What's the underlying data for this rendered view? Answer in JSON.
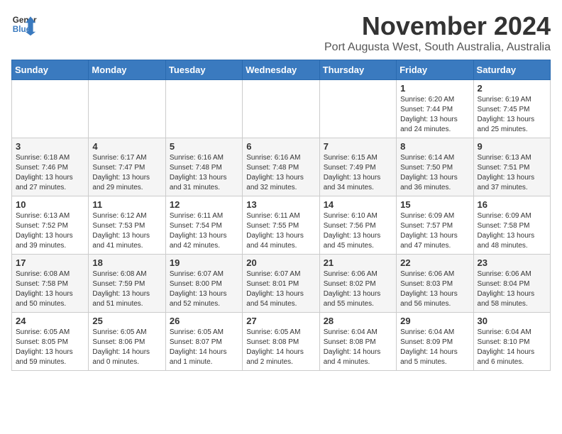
{
  "header": {
    "logo_line1": "General",
    "logo_line2": "Blue",
    "month": "November 2024",
    "location": "Port Augusta West, South Australia, Australia"
  },
  "days_of_week": [
    "Sunday",
    "Monday",
    "Tuesday",
    "Wednesday",
    "Thursday",
    "Friday",
    "Saturday"
  ],
  "weeks": [
    [
      {
        "day": "",
        "info": ""
      },
      {
        "day": "",
        "info": ""
      },
      {
        "day": "",
        "info": ""
      },
      {
        "day": "",
        "info": ""
      },
      {
        "day": "",
        "info": ""
      },
      {
        "day": "1",
        "info": "Sunrise: 6:20 AM\nSunset: 7:44 PM\nDaylight: 13 hours\nand 24 minutes."
      },
      {
        "day": "2",
        "info": "Sunrise: 6:19 AM\nSunset: 7:45 PM\nDaylight: 13 hours\nand 25 minutes."
      }
    ],
    [
      {
        "day": "3",
        "info": "Sunrise: 6:18 AM\nSunset: 7:46 PM\nDaylight: 13 hours\nand 27 minutes."
      },
      {
        "day": "4",
        "info": "Sunrise: 6:17 AM\nSunset: 7:47 PM\nDaylight: 13 hours\nand 29 minutes."
      },
      {
        "day": "5",
        "info": "Sunrise: 6:16 AM\nSunset: 7:48 PM\nDaylight: 13 hours\nand 31 minutes."
      },
      {
        "day": "6",
        "info": "Sunrise: 6:16 AM\nSunset: 7:48 PM\nDaylight: 13 hours\nand 32 minutes."
      },
      {
        "day": "7",
        "info": "Sunrise: 6:15 AM\nSunset: 7:49 PM\nDaylight: 13 hours\nand 34 minutes."
      },
      {
        "day": "8",
        "info": "Sunrise: 6:14 AM\nSunset: 7:50 PM\nDaylight: 13 hours\nand 36 minutes."
      },
      {
        "day": "9",
        "info": "Sunrise: 6:13 AM\nSunset: 7:51 PM\nDaylight: 13 hours\nand 37 minutes."
      }
    ],
    [
      {
        "day": "10",
        "info": "Sunrise: 6:13 AM\nSunset: 7:52 PM\nDaylight: 13 hours\nand 39 minutes."
      },
      {
        "day": "11",
        "info": "Sunrise: 6:12 AM\nSunset: 7:53 PM\nDaylight: 13 hours\nand 41 minutes."
      },
      {
        "day": "12",
        "info": "Sunrise: 6:11 AM\nSunset: 7:54 PM\nDaylight: 13 hours\nand 42 minutes."
      },
      {
        "day": "13",
        "info": "Sunrise: 6:11 AM\nSunset: 7:55 PM\nDaylight: 13 hours\nand 44 minutes."
      },
      {
        "day": "14",
        "info": "Sunrise: 6:10 AM\nSunset: 7:56 PM\nDaylight: 13 hours\nand 45 minutes."
      },
      {
        "day": "15",
        "info": "Sunrise: 6:09 AM\nSunset: 7:57 PM\nDaylight: 13 hours\nand 47 minutes."
      },
      {
        "day": "16",
        "info": "Sunrise: 6:09 AM\nSunset: 7:58 PM\nDaylight: 13 hours\nand 48 minutes."
      }
    ],
    [
      {
        "day": "17",
        "info": "Sunrise: 6:08 AM\nSunset: 7:58 PM\nDaylight: 13 hours\nand 50 minutes."
      },
      {
        "day": "18",
        "info": "Sunrise: 6:08 AM\nSunset: 7:59 PM\nDaylight: 13 hours\nand 51 minutes."
      },
      {
        "day": "19",
        "info": "Sunrise: 6:07 AM\nSunset: 8:00 PM\nDaylight: 13 hours\nand 52 minutes."
      },
      {
        "day": "20",
        "info": "Sunrise: 6:07 AM\nSunset: 8:01 PM\nDaylight: 13 hours\nand 54 minutes."
      },
      {
        "day": "21",
        "info": "Sunrise: 6:06 AM\nSunset: 8:02 PM\nDaylight: 13 hours\nand 55 minutes."
      },
      {
        "day": "22",
        "info": "Sunrise: 6:06 AM\nSunset: 8:03 PM\nDaylight: 13 hours\nand 56 minutes."
      },
      {
        "day": "23",
        "info": "Sunrise: 6:06 AM\nSunset: 8:04 PM\nDaylight: 13 hours\nand 58 minutes."
      }
    ],
    [
      {
        "day": "24",
        "info": "Sunrise: 6:05 AM\nSunset: 8:05 PM\nDaylight: 13 hours\nand 59 minutes."
      },
      {
        "day": "25",
        "info": "Sunrise: 6:05 AM\nSunset: 8:06 PM\nDaylight: 14 hours\nand 0 minutes."
      },
      {
        "day": "26",
        "info": "Sunrise: 6:05 AM\nSunset: 8:07 PM\nDaylight: 14 hours\nand 1 minute."
      },
      {
        "day": "27",
        "info": "Sunrise: 6:05 AM\nSunset: 8:08 PM\nDaylight: 14 hours\nand 2 minutes."
      },
      {
        "day": "28",
        "info": "Sunrise: 6:04 AM\nSunset: 8:08 PM\nDaylight: 14 hours\nand 4 minutes."
      },
      {
        "day": "29",
        "info": "Sunrise: 6:04 AM\nSunset: 8:09 PM\nDaylight: 14 hours\nand 5 minutes."
      },
      {
        "day": "30",
        "info": "Sunrise: 6:04 AM\nSunset: 8:10 PM\nDaylight: 14 hours\nand 6 minutes."
      }
    ]
  ]
}
